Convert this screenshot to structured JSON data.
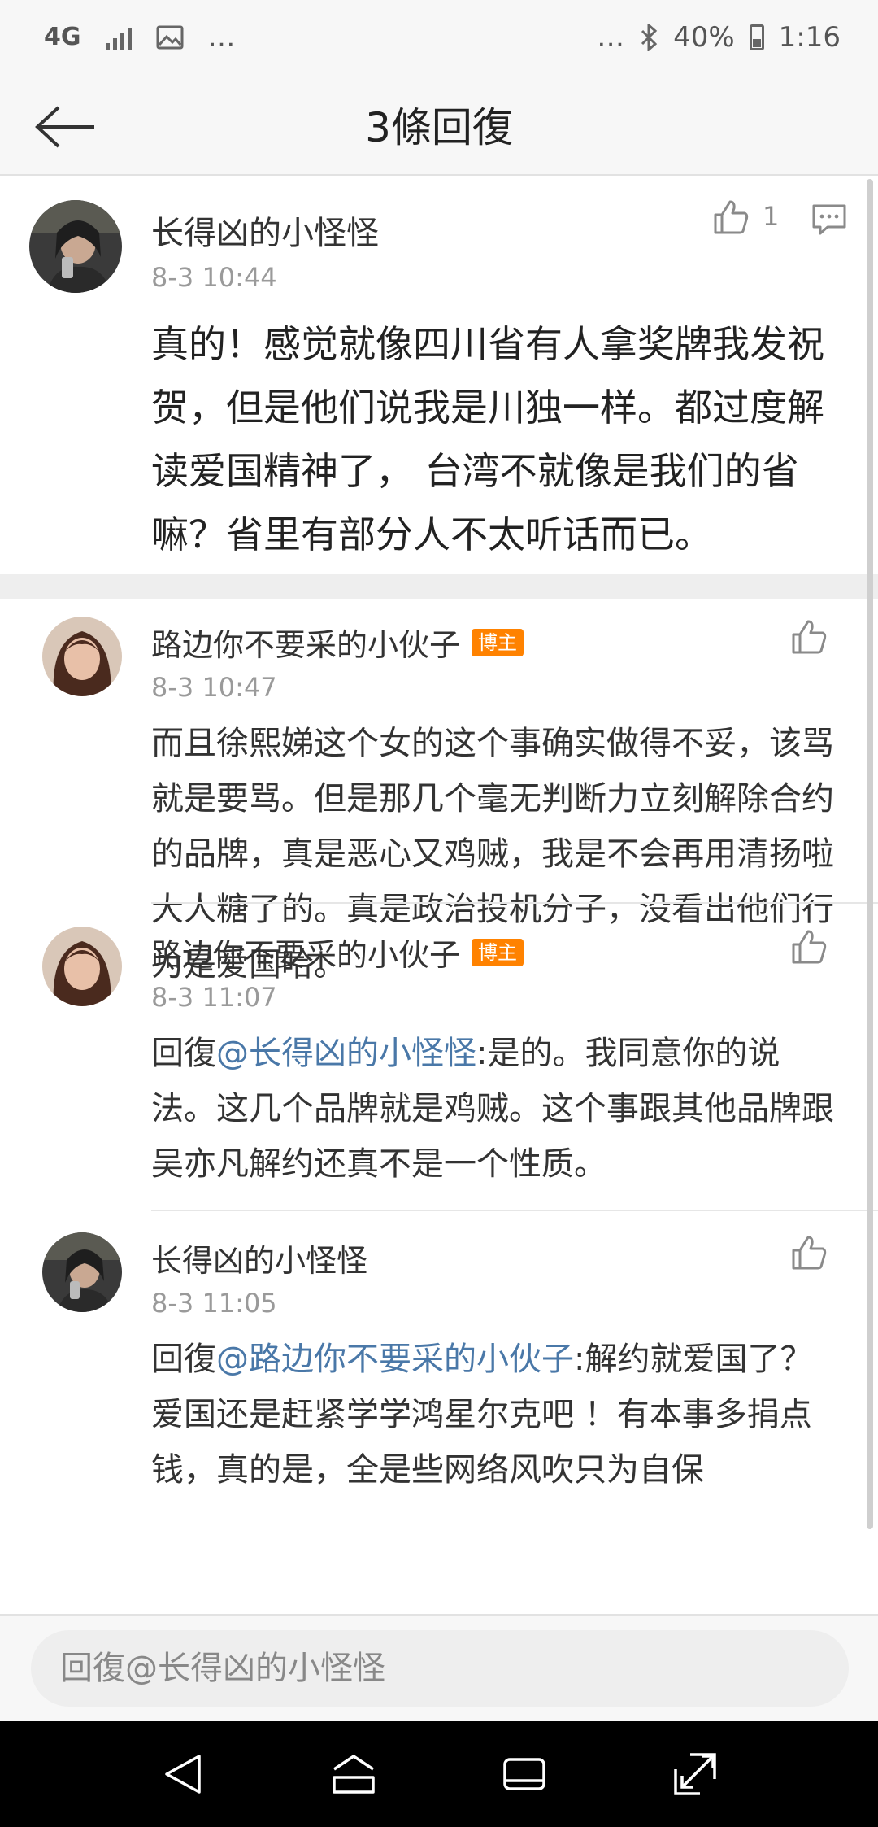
{
  "status": {
    "network": "4G",
    "battery": "40%",
    "time": "1:16"
  },
  "header": {
    "title": "3條回復"
  },
  "main_comment": {
    "author": "长得凶的小怪怪",
    "time": "8-3 10:44",
    "likes": "1",
    "text": "真的！感觉就像四川省有人拿奖牌我发祝贺，但是他们说我是川独一样。都过度解读爱国精神了， 台湾不就像是我们的省嘛？省里有部分人不太听话而已。"
  },
  "replies": [
    {
      "author": "路边你不要采的小伙子",
      "badge": "博主",
      "time": "8-3 10:47",
      "prefix": "",
      "mention": "",
      "text": "而且徐熙娣这个女的这个事确实做得不妥，该骂就是要骂。但是那几个毫无判断力立刻解除合约的品牌，真是恶心又鸡贼，我是不会再用清扬啦大人糖了的。真是政治投机分子，没看出他们行为是爱国哈。"
    },
    {
      "author": "路边你不要采的小伙子",
      "badge": "博主",
      "time": "8-3 11:07",
      "prefix": "回復",
      "mention": "@长得凶的小怪怪",
      "text": ":是的。我同意你的说法。这几个品牌就是鸡贼。这个事跟其他品牌跟吴亦凡解约还真不是一个性质。"
    },
    {
      "author": "长得凶的小怪怪",
      "badge": "",
      "time": "8-3 11:05",
      "prefix": "回復",
      "mention": "@路边你不要采的小伙子",
      "text": ":解约就爱国了？ 爱国还是赶紧学学鸿星尔克吧 ！有本事多捐点钱，真的是，全是些网络风吹只为自保"
    }
  ],
  "input": {
    "placeholder": "回復@长得凶的小怪怪"
  },
  "icons": {
    "back": "arrow-left-icon",
    "like": "thumbs-up-icon",
    "comment": "comment-icon",
    "nav_back": "triangle-back-icon",
    "nav_home": "home-icon",
    "nav_recent": "recent-apps-icon",
    "nav_expand": "expand-icon"
  },
  "colors": {
    "badge": "#ff8200",
    "mention": "#4a78a8",
    "nav": "#000000"
  }
}
